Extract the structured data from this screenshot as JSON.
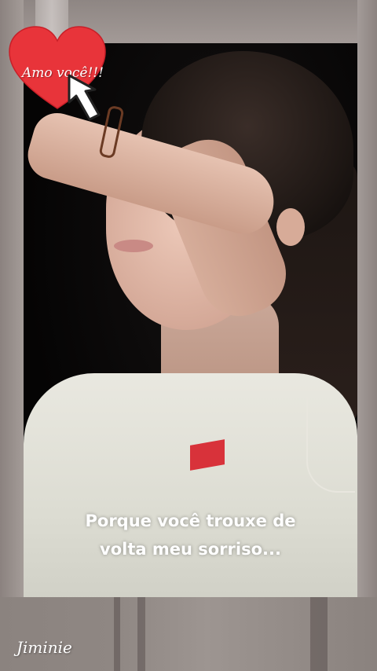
{
  "sticker": {
    "text": "Amo você!!!",
    "heart_color": "#e8343a",
    "icon": "heart-icon"
  },
  "caption": {
    "line1": "Porque você trouxe de",
    "line2": "volta meu sorriso..."
  },
  "watermark": {
    "text": "Jiminie"
  },
  "colors": {
    "frame": "#8d8481",
    "shirt": "#e9e8e0",
    "shirt_patch": "#d8323a"
  }
}
